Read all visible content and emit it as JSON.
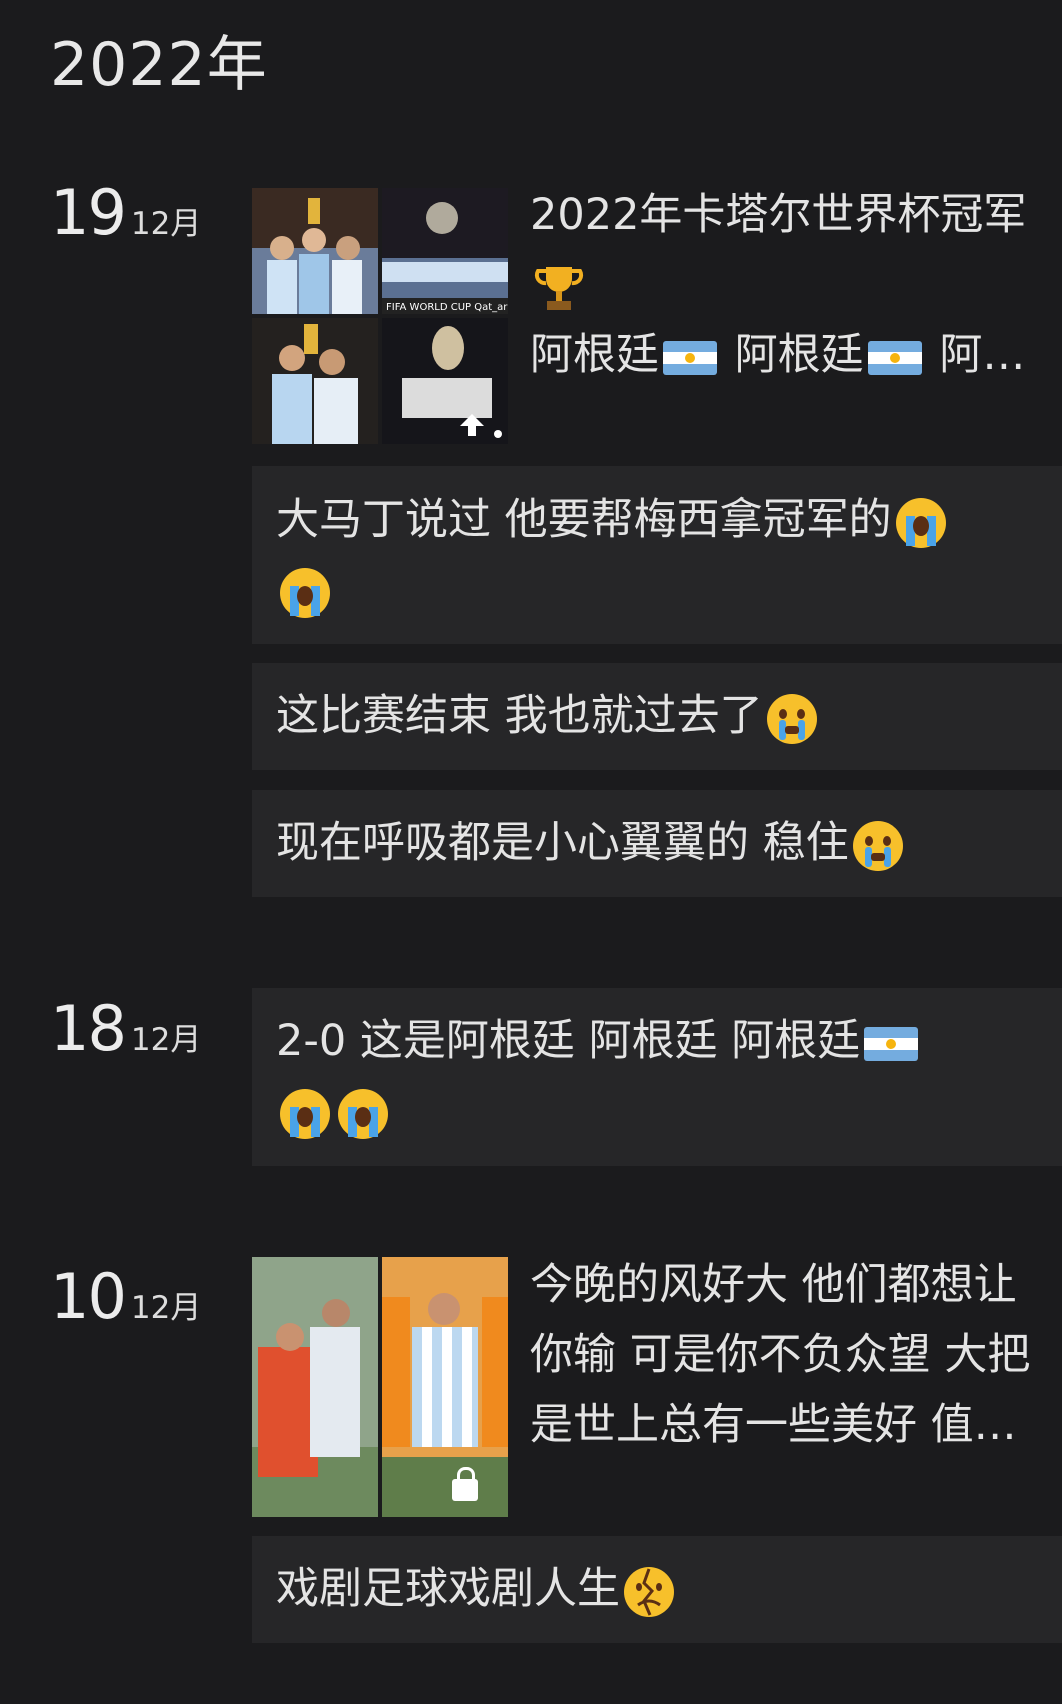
{
  "year_header": "2022年",
  "entries": [
    {
      "day": "19",
      "month": "12月",
      "post": {
        "line1": "2022年卡塔尔世界杯冠军",
        "line3_a": "阿根廷",
        "line3_b": "阿根廷",
        "line3_c": "阿…",
        "trophy_icon": "trophy-icon",
        "flag_icon": "argentina-flag-icon"
      },
      "comments": [
        "大马丁说过 他要帮梅西拿冠军的",
        "这比赛结束 我也就过去了",
        "现在呼吸都是小心翼翼的 稳住"
      ]
    },
    {
      "day": "18",
      "month": "12月",
      "comments": [
        "2-0 这是阿根廷 阿根廷 阿根廷"
      ]
    },
    {
      "day": "10",
      "month": "12月",
      "post": {
        "line1": "今晚的风好大 他们都想让",
        "line2": "你输 可是你不负众望  大把",
        "line3": "是世上总有一些美好 值…"
      },
      "comments": [
        "戏剧足球戏剧人生"
      ]
    }
  ],
  "colors": {
    "background": "#1b1b1d",
    "card": "#262628",
    "text": "#e4e4e4",
    "argentina_blue": "#74acdf",
    "emoji_yellow": "#f7c02b"
  }
}
